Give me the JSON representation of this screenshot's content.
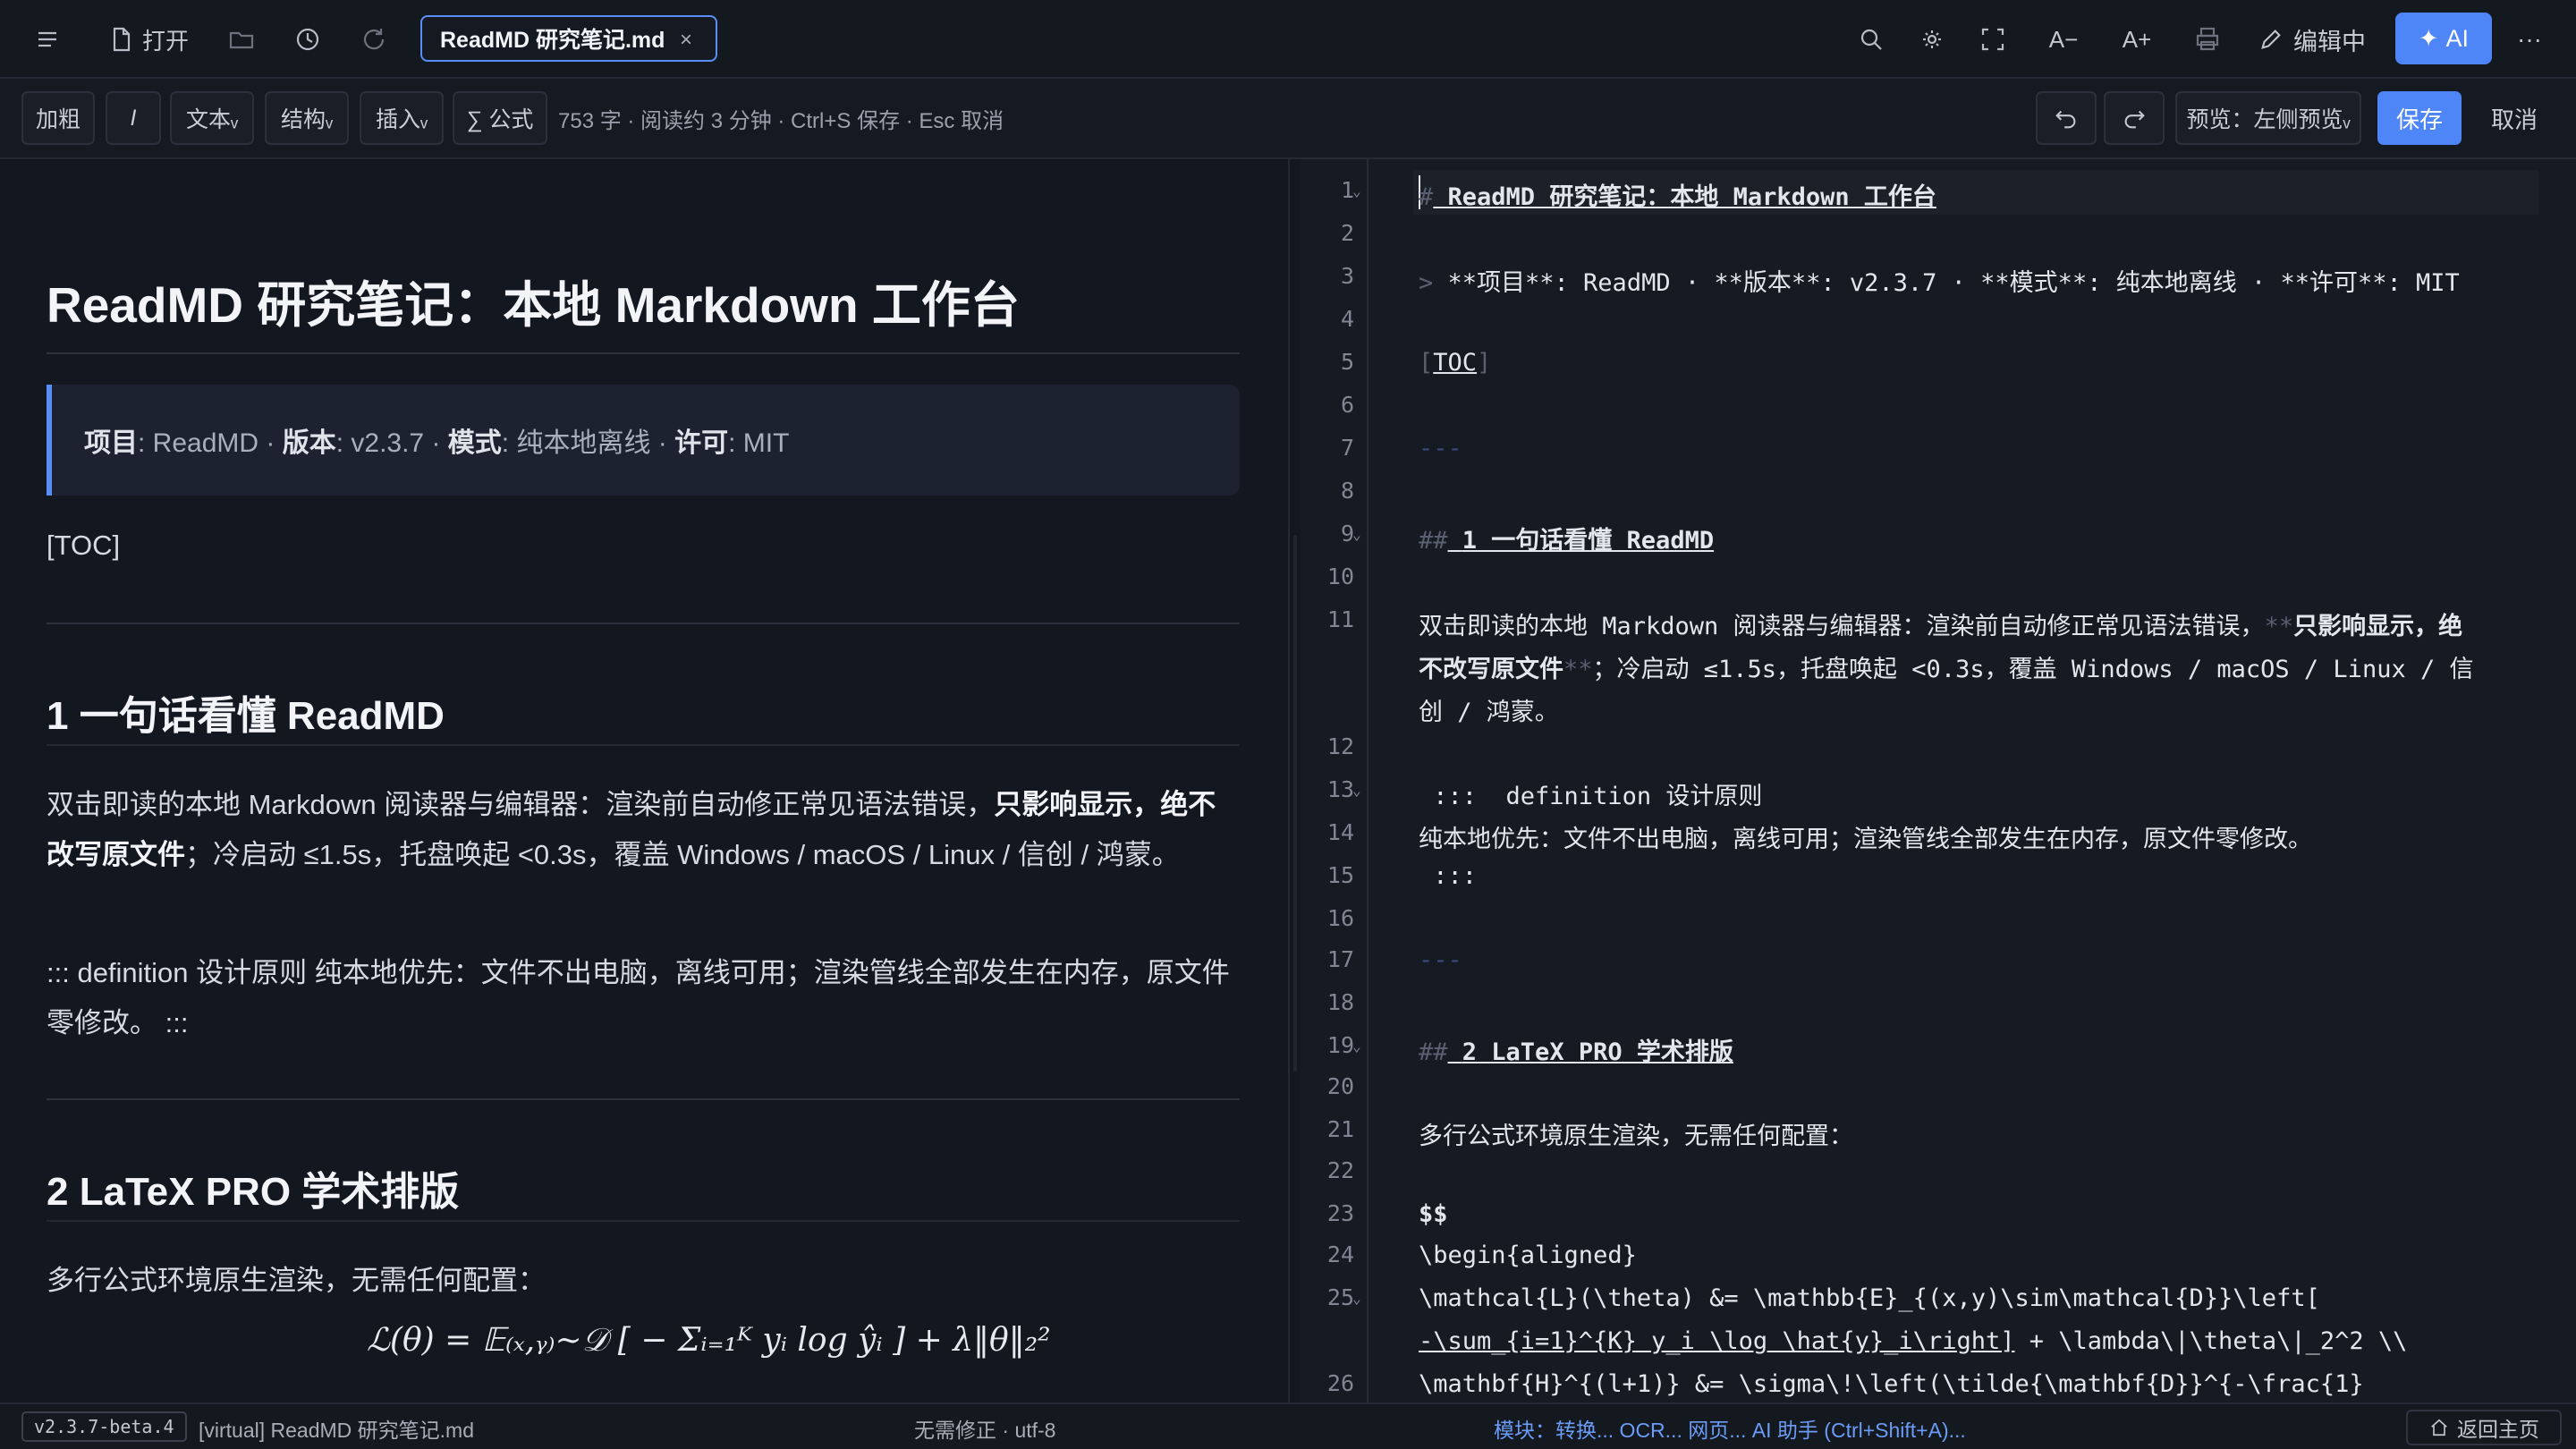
{
  "topbar": {
    "open_label": "打开",
    "tab_title": "ReadMD 研究笔记.md",
    "tab_close": "×",
    "font_decrease": "A−",
    "font_increase": "A+",
    "edit_status": "编辑中",
    "ai_label": "AI",
    "more": "···"
  },
  "toolbar": {
    "bold": "加粗",
    "italic": "I",
    "text": "文本ᵥ",
    "structure": "结构ᵥ",
    "insert": "插入ᵥ",
    "formula": "∑ 公式",
    "word_info": "753 字 · 阅读约 3 分钟 · Ctrl+S 保存 · Esc 取消",
    "preview_mode": "预览：左侧预览ᵥ",
    "save": "保存",
    "cancel": "取消"
  },
  "preview": {
    "title": "ReadMD 研究笔记：本地 Markdown 工作台",
    "quote": {
      "k1": "项目",
      "v1": ": ReadMD · ",
      "k2": "版本",
      "v2": ": v2.3.7 · ",
      "k3": "模式",
      "v3": ": 纯本地离线 · ",
      "k4": "许可",
      "v4": ": MIT"
    },
    "toc": "[TOC]",
    "h2_1": "1 一句话看懂 ReadMD",
    "p1_a": "双击即读的本地 Markdown 阅读器与编辑器：渲染前自动修正常见语法错误，",
    "p1_bold": "只影响显示，绝不改写原文件",
    "p1_b": "；冷启动 ≤1.5s，托盘唤起 <0.3s，覆盖 Windows / macOS / Linux / 信创 / 鸿蒙。",
    "p2": "::: definition 设计原则 纯本地优先：文件不出电脑，离线可用；渲染管线全部发生在内存，原文件零修改。 :::",
    "h2_2": "2 LaTeX PRO 学术排版",
    "p3": "多行公式环境原生渲染，无需任何配置：",
    "math": "ℒ(θ) = 𝔼₍ₓ,ᵧ₎∼𝒟 [ − Σᵢ₌₁ᴷ yᵢ log ŷᵢ ] + λ‖θ‖₂²"
  },
  "editor": {
    "line_numbers": [
      "1",
      "2",
      "3",
      "4",
      "5",
      "6",
      "7",
      "8",
      "9",
      "10",
      "11",
      "12",
      "13",
      "14",
      "15",
      "16",
      "17",
      "18",
      "19",
      "20",
      "21",
      "22",
      "23",
      "24",
      "25",
      "26"
    ],
    "l1": "ReadMD 研究笔记：本地 Markdown 工作台",
    "l3": "**项目**: ReadMD · **版本**: v2.3.7 · **模式**: 纯本地离线 · **许可**: MIT",
    "l5": "TOC",
    "l7": "---",
    "l9": "1 一句话看懂 ReadMD",
    "l11_a": "双击即读的本地 Markdown 阅读器与编辑器：渲染前自动修正常见语法错误，",
    "l11_b": "只影响显示，绝",
    "l11_c": "不改写原文件",
    "l11_d": "；冷启动 ≤1.5s，托盘唤起 <0.3s，覆盖 Windows / macOS / Linux / 信",
    "l11_e": "创 / 鸿蒙。",
    "l13": " :::  definition 设计原则",
    "l14": "纯本地优先：文件不出电脑，离线可用；渲染管线全部发生在内存，原文件零修改。",
    "l15": " :::",
    "l17": "---",
    "l19": "2 LaTeX PRO 学术排版",
    "l21": "多行公式环境原生渲染，无需任何配置：",
    "l23": "$$",
    "l24": "\\begin{aligned}",
    "l25_a": "\\mathcal{L}(\\theta) &= \\mathbb{E}_{(x,y)\\sim\\mathcal{D}}\\left[",
    "l25_b": "-\\sum_{i=1}^{K} y_i \\log \\hat{y}_i\\right]",
    "l25_c": " + \\lambda\\|\\theta\\|_2^2 \\\\",
    "l26": "\\mathbf{H}^{(l+1)} &= \\sigma\\!\\left(\\tilde{\\mathbf{D}}^{-\\frac{1}"
  },
  "statusbar": {
    "version": "v2.3.7-beta.4",
    "file": "[virtual] ReadMD 研究笔记.md",
    "encoding": "无需修正 · utf-8",
    "modules": "模块：转换... OCR... 网页... AI 助手 (Ctrl+Shift+A)...",
    "home": "返回主页"
  },
  "colors": {
    "accent": "#4f86f7",
    "background": "#13171f",
    "latex_red": "#e0533f"
  }
}
